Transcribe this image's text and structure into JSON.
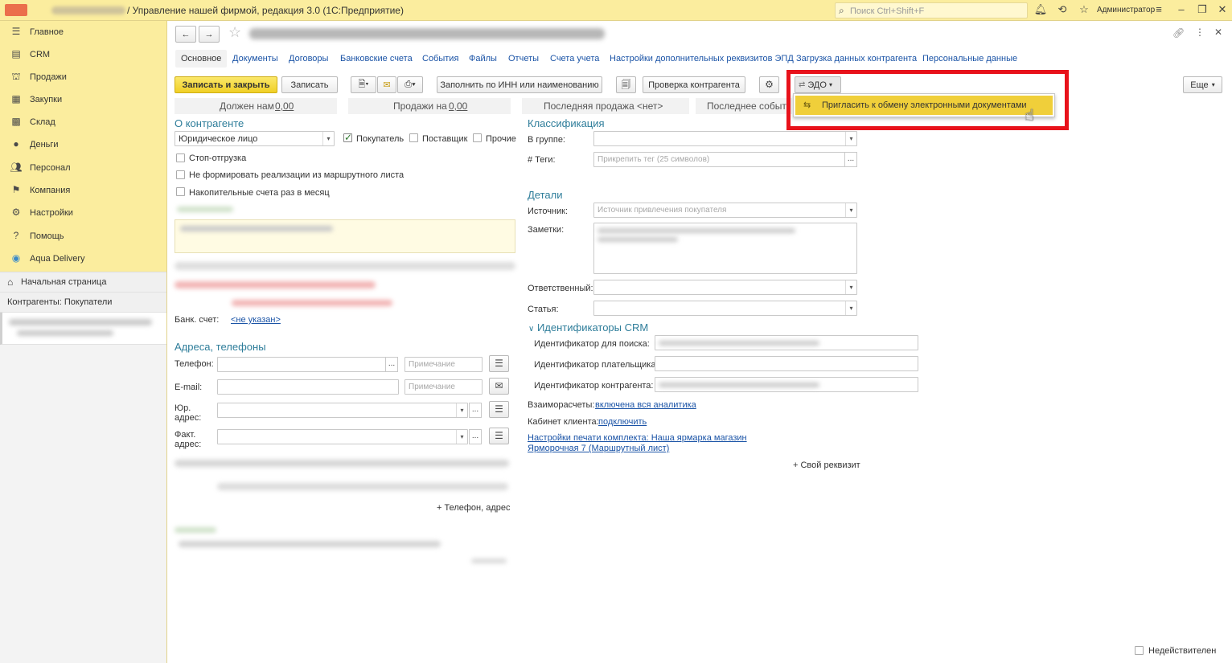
{
  "window": {
    "title": "/ Управление нашей фирмой, редакция 3.0  (1С:Предприятие)",
    "search_placeholder": "Поиск Ctrl+Shift+F",
    "user": "Администратор"
  },
  "sidebar": {
    "items": [
      {
        "label": "Главное",
        "icon": "menu-icon"
      },
      {
        "label": "CRM",
        "icon": "crm-icon"
      },
      {
        "label": "Продажи",
        "icon": "basket-icon"
      },
      {
        "label": "Закупки",
        "icon": "purchase-icon"
      },
      {
        "label": "Склад",
        "icon": "warehouse-icon"
      },
      {
        "label": "Деньги",
        "icon": "money-icon"
      },
      {
        "label": "Персонал",
        "icon": "people-icon"
      },
      {
        "label": "Компания",
        "icon": "flag-icon"
      },
      {
        "label": "Настройки",
        "icon": "gear-icon"
      },
      {
        "label": "Помощь",
        "icon": "help-icon"
      },
      {
        "label": "Aqua Delivery",
        "icon": "location-icon"
      }
    ],
    "home_page": "Начальная страница",
    "open_window": "Контрагенты: Покупатели"
  },
  "tabs": [
    "Основное",
    "Документы",
    "Договоры",
    "Банковские счета",
    "События",
    "Файлы",
    "Отчеты",
    "Счета учета",
    "Настройки дополнительных реквизитов ЭПД",
    "Загрузка данных контрагента",
    "Персональные данные"
  ],
  "toolbar": {
    "save_close": "Записать и закрыть",
    "save": "Записать",
    "fill_inn": "Заполнить по ИНН или наименованию",
    "check": "Проверка контрагента",
    "edo": "ЭДО",
    "more": "Еще"
  },
  "edo_menu": {
    "invite": "Пригласить к обмену электронными документами"
  },
  "summary": {
    "owed": "Должен нам",
    "owed_value": "0,00",
    "sales": "Продажи на",
    "sales_value": "0,00",
    "last_sale": "Последняя продажа <нет>",
    "last_event": "Последнее событ"
  },
  "about": {
    "title": "О контрагенте",
    "type_value": "Юридическое лицо",
    "buyer": "Покупатель",
    "supplier": "Поставщик",
    "other": "Прочие",
    "stop_shipping": "Стоп-отгрузка",
    "no_route_sales": "Не формировать реализации из маршрутного листа",
    "monthly_invoices": "Накопительные счета раз в месяц",
    "bank_account_label": "Банк. счет:",
    "bank_account_value": "<не указан>"
  },
  "addresses": {
    "title": "Адреса, телефоны",
    "phone": "Телефон:",
    "email": "E-mail:",
    "legal": "Юр. адрес:",
    "actual": "Факт. адрес:",
    "note_placeholder": "Примечание",
    "add_phone": "+ Телефон, адрес"
  },
  "classification": {
    "title": "Классификация",
    "group": "В группе:",
    "tags": "#  Теги:",
    "tags_placeholder": "Прикрепить тег (25 символов)"
  },
  "details": {
    "title": "Детали",
    "source": "Источник:",
    "source_placeholder": "Источник привлечения покупателя",
    "notes": "Заметки:",
    "responsible": "Ответственный:",
    "article": "Статья:"
  },
  "crm": {
    "title": "Идентификаторы CRM",
    "search_id": "Идентификатор для поиска:",
    "payer_id": "Идентификатор плательщика:",
    "contractor_id": "Идентификатор контрагента:",
    "settlements_label": "Взаиморасчеты:",
    "settlements_value": "включена вся аналитика",
    "cabinet_label": "Кабинет клиента:",
    "cabinet_value": "подключить",
    "print_settings_1": "Настройки печати комплекта: Наша ярмарка магазин",
    "print_settings_2": "Ярморочная 7 (Маршрутный лист)",
    "add_attr": "+ Свой реквизит"
  },
  "footer": {
    "inactive": "Недействителен"
  }
}
